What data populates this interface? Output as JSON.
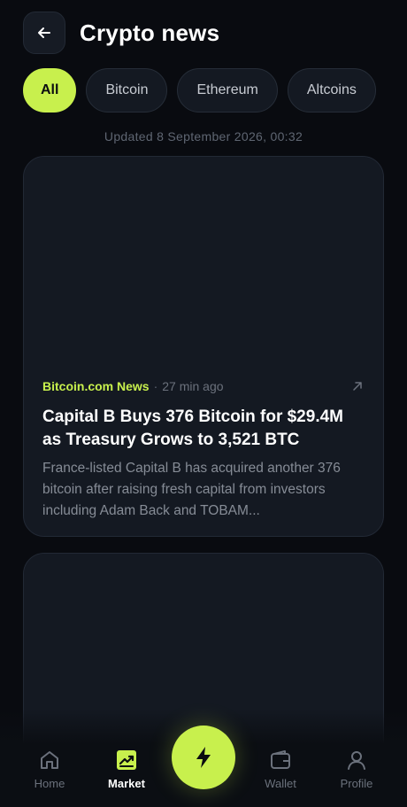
{
  "header": {
    "title": "Crypto news",
    "back_icon": "arrow-left-icon"
  },
  "filters": [
    {
      "label": "All",
      "active": true
    },
    {
      "label": "Bitcoin",
      "active": false
    },
    {
      "label": "Ethereum",
      "active": false
    },
    {
      "label": "Altcoins",
      "active": false
    }
  ],
  "updated_text": "Updated 8 September 2026, 00:32",
  "articles": [
    {
      "source": "Bitcoin.com News",
      "separator": "·",
      "time": "27 min ago",
      "title": "Capital B Buys 376 Bitcoin for $29.4M as Treasury Grows to 3,521 BTC",
      "description": "France-listed Capital B has acquired another 376 bitcoin after raising fresh capital from investors including Adam Back and TOBAM...",
      "link_icon": "external-link-icon"
    }
  ],
  "nav": {
    "home_label": "Home",
    "market_label": "Market",
    "wallet_label": "Wallet",
    "profile_label": "Profile",
    "active": "Market",
    "action_icon": "lightning-bolt-icon"
  },
  "colors": {
    "accent": "#c8f04d",
    "background": "#090b10",
    "card": "#141922",
    "muted_text": "#868c96"
  }
}
